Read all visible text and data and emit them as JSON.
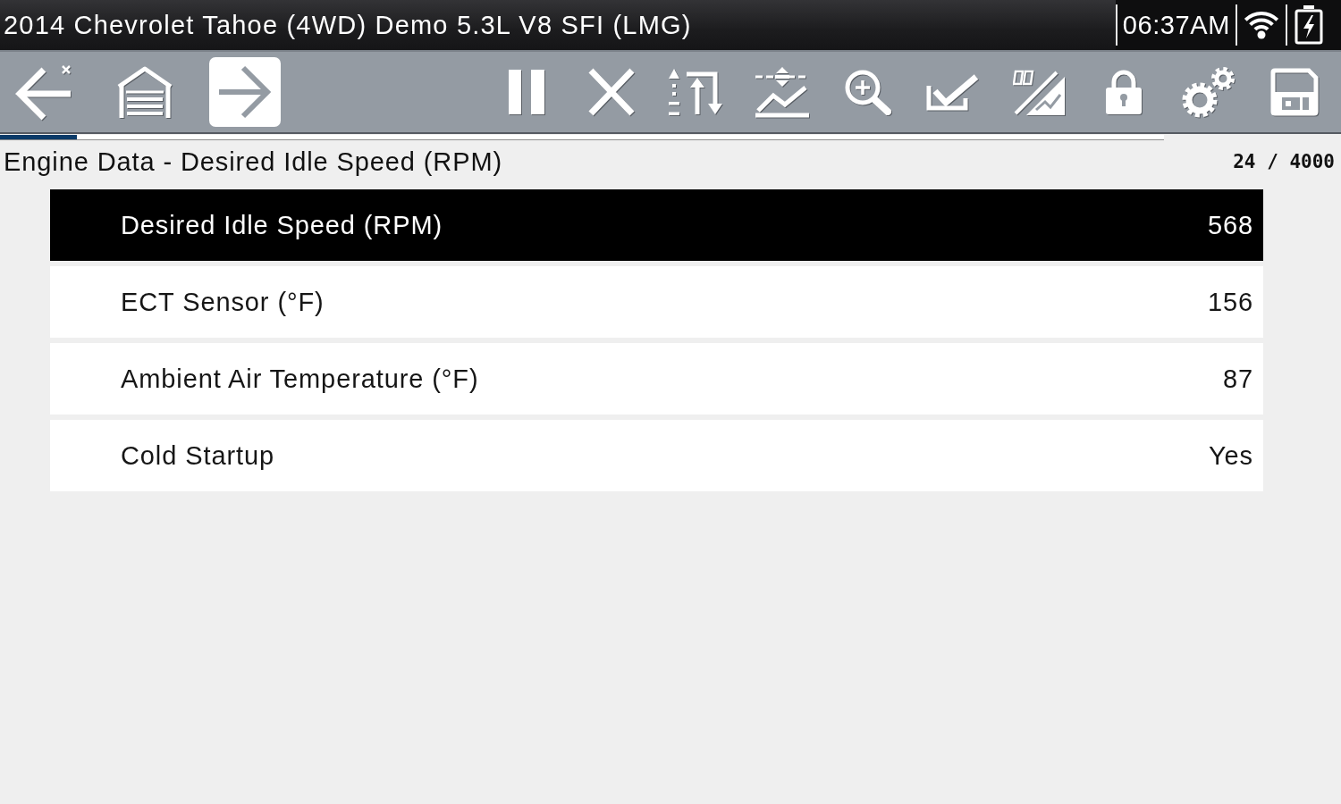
{
  "status_bar": {
    "title": "2014 Chevrolet Tahoe (4WD) Demo 5.3L V8 SFI (LMG)",
    "time": "06:37AM"
  },
  "toolbar": {
    "nav_buttons": [
      {
        "kind": "back",
        "selected": false
      },
      {
        "kind": "home",
        "selected": false
      },
      {
        "kind": "forward",
        "selected": true
      }
    ],
    "tool_buttons": [
      {
        "kind": "pause"
      },
      {
        "kind": "clear"
      },
      {
        "kind": "sort"
      },
      {
        "kind": "threshold"
      },
      {
        "kind": "zoom"
      },
      {
        "kind": "select"
      },
      {
        "kind": "graph"
      },
      {
        "kind": "lock"
      },
      {
        "kind": "settings"
      },
      {
        "kind": "save"
      }
    ]
  },
  "progress": {
    "level": 0.066
  },
  "header": {
    "title": "Engine Data - Desired Idle Speed (RPM)",
    "counter": "24 / 4000"
  },
  "rows": [
    {
      "label": "Desired Idle Speed (RPM)",
      "value": "568",
      "selected": true
    },
    {
      "label": "ECT Sensor (°F)",
      "value": "156",
      "selected": false
    },
    {
      "label": "Ambient Air Temperature (°F)",
      "value": "87",
      "selected": false
    },
    {
      "label": "Cold Startup",
      "value": "Yes",
      "selected": false
    }
  ]
}
